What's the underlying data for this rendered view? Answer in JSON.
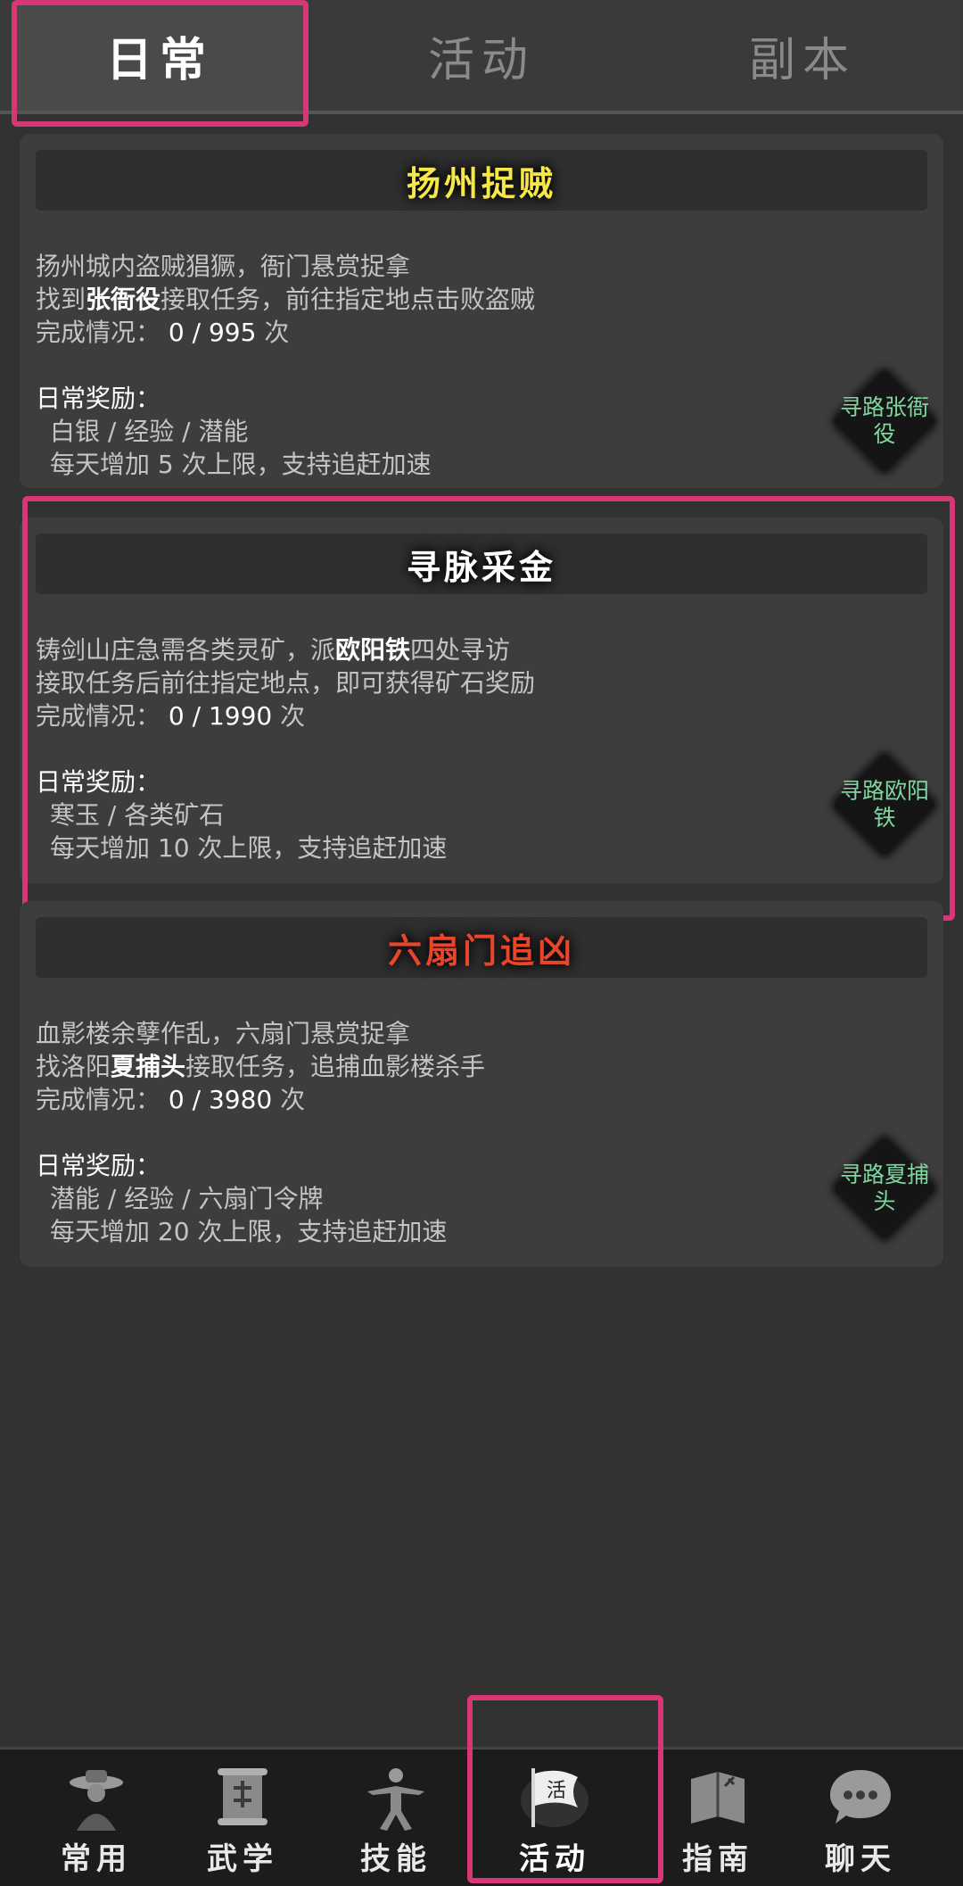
{
  "tabs": [
    {
      "label": "日常"
    },
    {
      "label": "活动"
    },
    {
      "label": "副本"
    }
  ],
  "cards": [
    {
      "title": "扬州捉贼",
      "title_color": "#f5e64a",
      "line1": "扬州城内盗贼猖獗，衙门悬赏捉拿",
      "line2_pre": "找到",
      "line2_bold": "张衙役",
      "line2_post": "接取任务，前往指定地点击败盗贼",
      "progress_label": "完成情况：",
      "progress_value": "0 / 995",
      "progress_unit": "次",
      "reward_title": "日常奖励：",
      "reward_items": "白银 / 经验 / 潜能",
      "reward_note": "每天增加 5 次上限，支持追赶加速",
      "nav_button": "寻路张衙役"
    },
    {
      "title": "寻脉采金",
      "title_color": "#ffffff",
      "line1_pre": "铸剑山庄急需各类灵矿，派",
      "line1_bold": "欧阳铁",
      "line1_post": "四处寻访",
      "line2": "接取任务后前往指定地点，即可获得矿石奖励",
      "progress_label": "完成情况：",
      "progress_value": "0 / 1990",
      "progress_unit": "次",
      "reward_title": "日常奖励：",
      "reward_items": "寒玉 / 各类矿石",
      "reward_note": "每天增加 10 次上限，支持追赶加速",
      "nav_button": "寻路欧阳铁"
    },
    {
      "title": "六扇门追凶",
      "title_color": "#e8452a",
      "line1": "血影楼余孽作乱，六扇门悬赏捉拿",
      "line2_pre": "找洛阳",
      "line2_bold": "夏捕头",
      "line2_post": "接取任务，追捕血影楼杀手",
      "progress_label": "完成情况：",
      "progress_value": "0 / 3980",
      "progress_unit": "次",
      "reward_title": "日常奖励：",
      "reward_items": "潜能 / 经验 / 六扇门令牌",
      "reward_note": "每天增加 20 次上限，支持追赶加速",
      "nav_button": "寻路夏捕头"
    }
  ],
  "bottom_nav": [
    {
      "label": "常用",
      "icon": "hat-figure-icon"
    },
    {
      "label": "武学",
      "icon": "scroll-icon"
    },
    {
      "label": "技能",
      "icon": "martial-pose-icon"
    },
    {
      "label": "活动",
      "icon": "flag-icon",
      "badge": "活"
    },
    {
      "label": "指南",
      "icon": "book-icon"
    },
    {
      "label": "聊天",
      "icon": "chat-bubble-icon"
    }
  ]
}
